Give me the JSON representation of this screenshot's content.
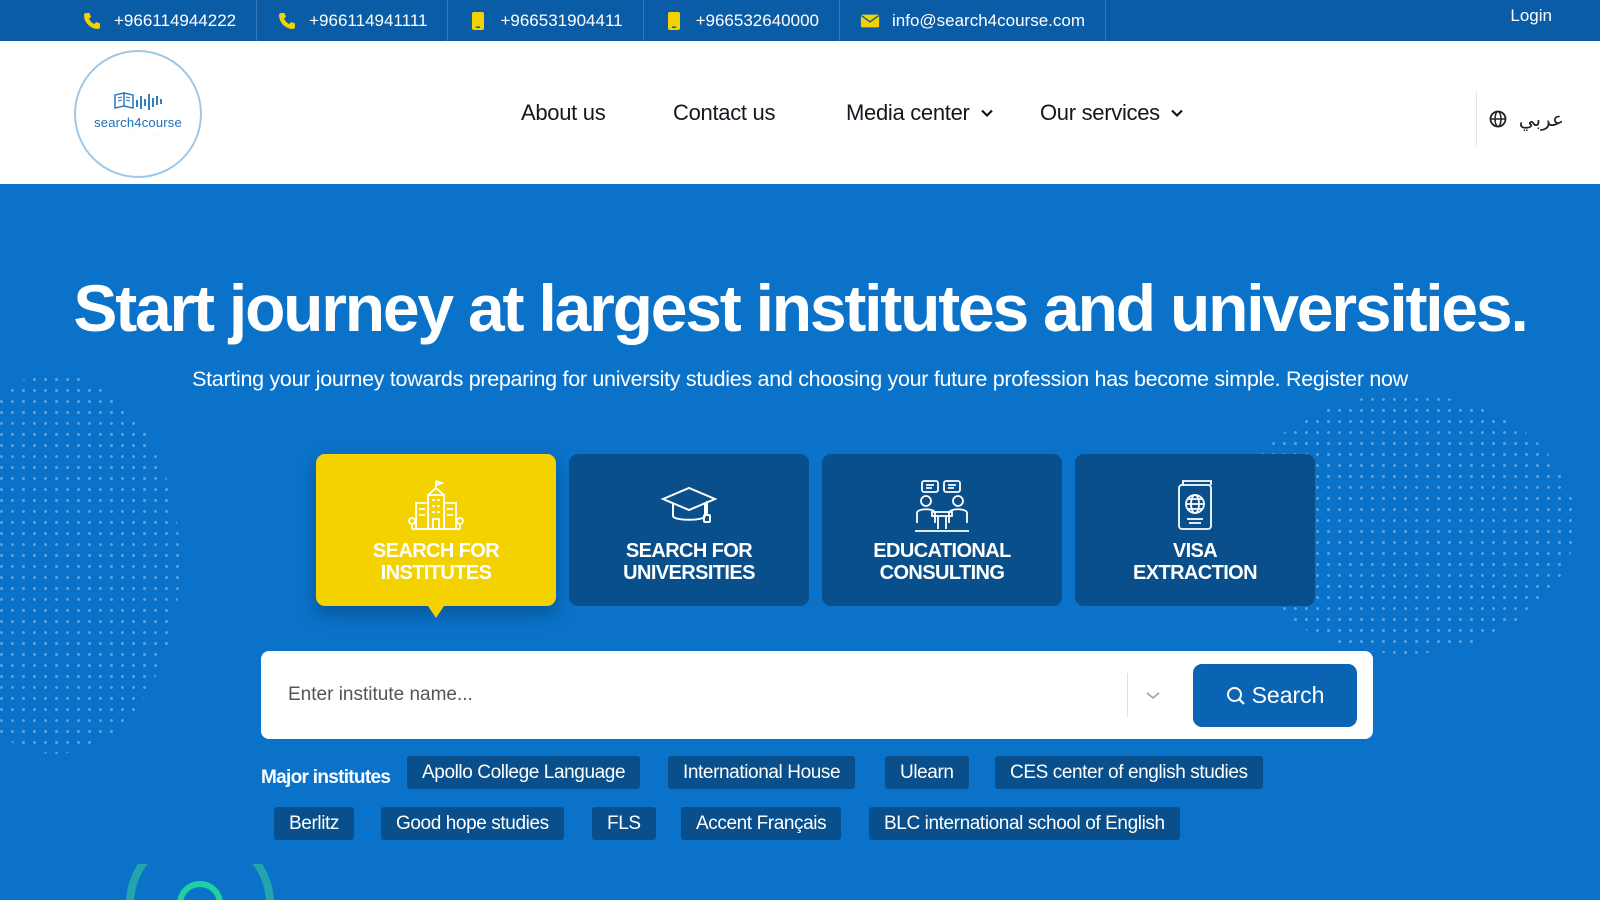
{
  "topbar": {
    "contacts": [
      {
        "icon": "phone-icon",
        "text": "+966114944222"
      },
      {
        "icon": "phone-icon",
        "text": "+966114941111"
      },
      {
        "icon": "mobile-icon",
        "text": "+966531904411"
      },
      {
        "icon": "mobile-icon",
        "text": "+966532640000"
      },
      {
        "icon": "mail-icon",
        "text": "info@search4course.com"
      }
    ],
    "login": "Login"
  },
  "header": {
    "logo_text": "search4course",
    "nav": [
      {
        "label": "About us",
        "dropdown": false
      },
      {
        "label": "Contact us",
        "dropdown": false
      },
      {
        "label": "Media center",
        "dropdown": true
      },
      {
        "label": "Our services",
        "dropdown": true
      }
    ],
    "language": "عربي"
  },
  "hero": {
    "headline": "Start journey at largest institutes and universities.",
    "subline": "Starting your journey towards preparing for university studies and choosing your future profession has become simple. Register now",
    "tabs": [
      {
        "line1": "SEARCH FOR",
        "line2": "INSTITUTES",
        "icon": "building-icon",
        "active": true
      },
      {
        "line1": "SEARCH FOR",
        "line2": "UNIVERSITIES",
        "icon": "graduation-cap-icon",
        "active": false
      },
      {
        "line1": "EDUCATIONAL",
        "line2": "CONSULTING",
        "icon": "consulting-icon",
        "active": false
      },
      {
        "line1": "VISA",
        "line2": "EXTRACTION",
        "icon": "passport-icon",
        "active": false
      }
    ],
    "search": {
      "placeholder": "Enter institute name...",
      "value": "",
      "button": "Search"
    },
    "major_label": "Major institutes",
    "institutes": [
      "Apollo College Language",
      "International House",
      "Ulearn",
      "CES center of english studies",
      "Berlitz",
      "Good hope studies",
      "FLS",
      "Accent Français",
      "BLC international school of English"
    ]
  },
  "colors": {
    "topbar": "#0b5ca6",
    "hero": "#0a72c9",
    "tab": "#094f8c",
    "tab_active": "#f3d200",
    "button": "#0b63b3"
  }
}
